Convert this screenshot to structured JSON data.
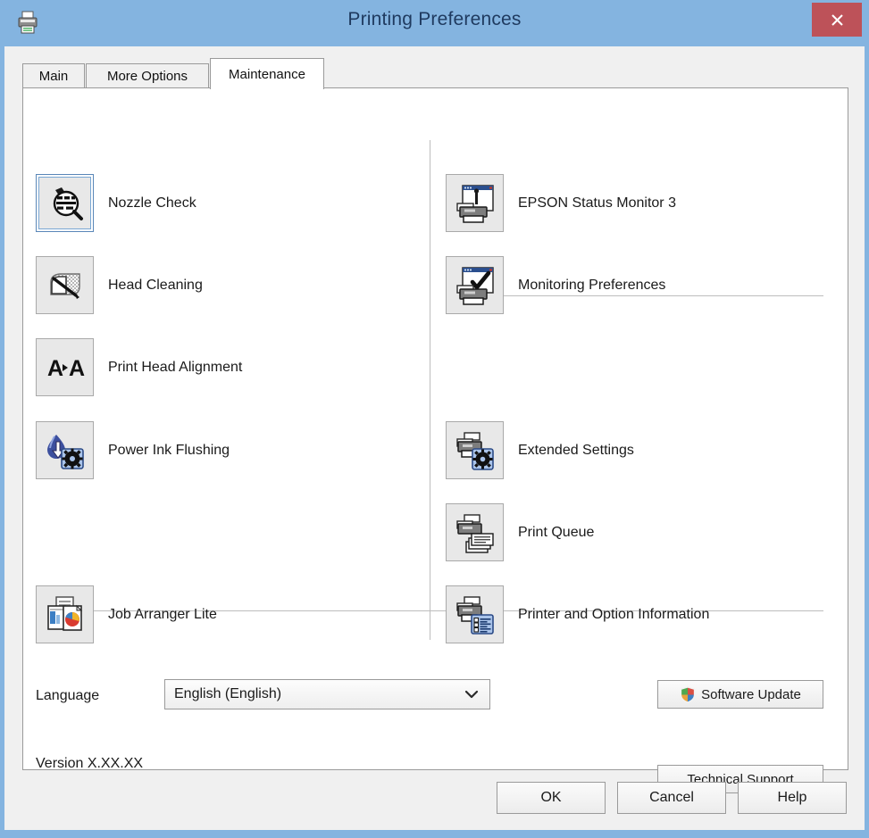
{
  "window": {
    "title": "Printing Preferences",
    "titlebar_color": "#84b4e0",
    "close_label": "✕",
    "close_color": "#bd5259",
    "printer_icon": "printer-icon"
  },
  "tabs": [
    {
      "label": "Main",
      "active": false
    },
    {
      "label": "More Options",
      "active": false
    },
    {
      "label": "Maintenance",
      "active": true
    }
  ],
  "maintenance": {
    "left_column": [
      {
        "label": "Nozzle Check",
        "icon": "nozzle-check-icon",
        "focused": true
      },
      {
        "label": "Head Cleaning",
        "icon": "head-cleaning-icon",
        "focused": false
      },
      {
        "label": "Print Head Alignment",
        "icon": "head-alignment-icon",
        "focused": false
      },
      {
        "label": "Power Ink Flushing",
        "icon": "ink-flushing-icon",
        "focused": false
      },
      {
        "label": "Job Arranger Lite",
        "icon": "job-arranger-icon",
        "focused": false
      }
    ],
    "right_column": [
      {
        "label": "EPSON Status Monitor 3",
        "icon": "status-monitor-icon",
        "focused": false
      },
      {
        "label": "Monitoring Preferences",
        "icon": "monitoring-prefs-icon",
        "focused": false
      },
      {
        "label": "Extended Settings",
        "icon": "extended-settings-icon",
        "focused": false
      },
      {
        "label": "Print Queue",
        "icon": "print-queue-icon",
        "focused": false
      },
      {
        "label": "Printer and Option Information",
        "icon": "printer-info-icon",
        "focused": false
      }
    ]
  },
  "language": {
    "label": "Language",
    "selected": "English (English)",
    "options": [
      "English (English)"
    ]
  },
  "version": {
    "text": "Version  X.XX.XX"
  },
  "side_buttons": {
    "software_update": "Software Update",
    "technical_support": "Technical Support"
  },
  "footer": {
    "ok": "OK",
    "cancel": "Cancel",
    "help": "Help"
  }
}
